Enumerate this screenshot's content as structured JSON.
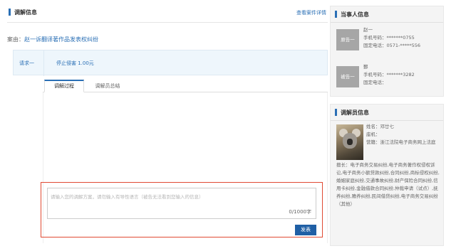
{
  "main": {
    "title": "调解信息",
    "detail_link": "查看案件详情",
    "case_label": "案由：",
    "case_value": "赵一诉翻译著作品发表权纠纷",
    "request": {
      "label": "请求一",
      "value": "停止侵害 1.00元"
    },
    "tabs": [
      {
        "label": "调解过程",
        "active": true
      },
      {
        "label": "调解员总结",
        "active": false
      }
    ],
    "composer": {
      "placeholder": "请输入您的调解方案，请勿输入有导性语言（被告无法看到您输入的信息）",
      "counter": "0/1000字",
      "send_label": "发表"
    }
  },
  "sidebar": {
    "parties": {
      "title": "当事人信息",
      "items": [
        {
          "role": "原告一",
          "name": "赵一",
          "phone": "手机号码：*******0755",
          "landline": "固定电话：0571-*****556"
        },
        {
          "role": "被告一",
          "name": "鄞",
          "phone": "手机号码：*******3282",
          "landline": "固定电话："
        }
      ]
    },
    "mediator": {
      "title": "调解员信息",
      "name": "姓名：邓廿七",
      "mobile": "座机：",
      "org": "营籍：浙江法院电子商务网上法庭",
      "specialty": "擅长：电子商务交易纠纷,电子商务著作权侵权诉讼,电子商务小额贷款纠纷,合同纠纷,商标侵权纠纷,婚姻家庭纠纷,交通事故纠纷,财产保险合同纠纷,信用卡纠纷,金融借款合同纠纷,仲裁申请（试点）,抚养纠纷,赡养纠纷,民间借贷纠纷,电子商务交易纠纷（其他）"
    }
  },
  "colors": {
    "accent": "#2a6fb5",
    "highlight_border": "#e04a33",
    "send_button": "#1f5fa5",
    "request_bg": "#eef6fc"
  }
}
